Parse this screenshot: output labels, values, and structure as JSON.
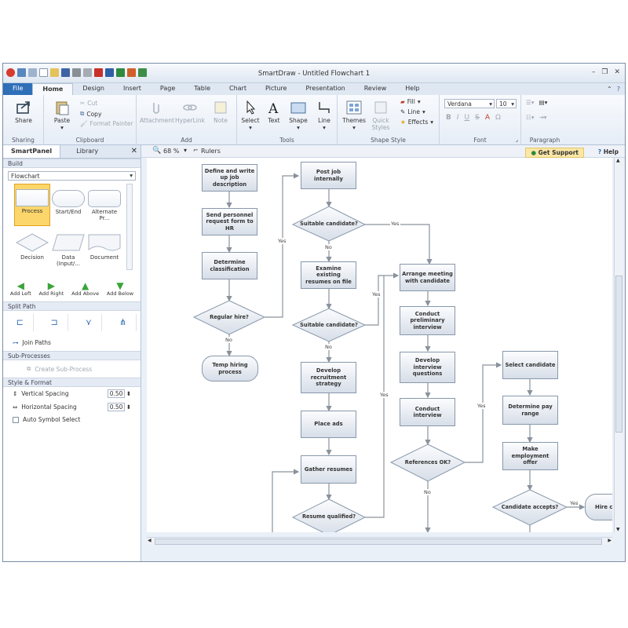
{
  "window": {
    "title": "SmartDraw - Untitled Flowchart 1"
  },
  "tabs": [
    "File",
    "Home",
    "Design",
    "Insert",
    "Page",
    "Table",
    "Chart",
    "Picture",
    "Presentation",
    "Review",
    "Help"
  ],
  "ribbon": {
    "sharing": {
      "label": "Sharing",
      "share": "Share"
    },
    "clipboard": {
      "label": "Clipboard",
      "paste": "Paste",
      "cut": "Cut",
      "copy": "Copy",
      "format_painter": "Format Painter"
    },
    "add": {
      "label": "Add",
      "attachment": "Attachment",
      "hyperlink": "HyperLink",
      "note": "Note"
    },
    "tools": {
      "label": "Tools",
      "select": "Select",
      "text": "Text",
      "shape": "Shape",
      "line": "Line"
    },
    "shape_style": {
      "label": "Shape Style",
      "themes": "Themes",
      "quick_styles_1": "Quick",
      "quick_styles_2": "Styles",
      "fill": "Fill",
      "line": "Line",
      "effects": "Effects"
    },
    "font": {
      "label": "Font",
      "name": "Verdana",
      "size": "10"
    },
    "paragraph": {
      "label": "Paragraph"
    }
  },
  "panel": {
    "tabs": [
      "SmartPanel",
      "Library"
    ],
    "build": "Build",
    "template": "Flowchart",
    "shapes": [
      "Process",
      "Start/End",
      "Alternate Pr...",
      "Decision",
      "Data (Input/...",
      "Document"
    ],
    "adds": [
      "Add Left",
      "Add Right",
      "Add Above",
      "Add Below"
    ],
    "split_path": "Split Path",
    "join_paths": "Join Paths",
    "sub_processes": "Sub-Processes",
    "create_sub": "Create Sub-Process",
    "style_format": "Style & Format",
    "vertical_spacing": "Vertical Spacing",
    "horizontal_spacing": "Horizontal Spacing",
    "v_value": "0.50",
    "h_value": "0.50",
    "auto_symbol": "Auto Symbol Select"
  },
  "canvasbar": {
    "zoom": "68 %",
    "rulers": "Rulers",
    "get_support": "Get Support",
    "help": "Help"
  },
  "flow": {
    "n1": "Define and write up job description",
    "n2": "Send personnel request form to HR",
    "n3": "Determine classification",
    "d1": "Regular hire?",
    "t1": "Temp hiring process",
    "n4": "Post job internally",
    "d2": "Suitable candidate?",
    "n5": "Examine existing resumes on file",
    "d3": "Suitable candidate?",
    "n6": "Develop recruitment strategy",
    "n7": "Place ads",
    "n8": "Gather resumes",
    "d4": "Resume qualified?",
    "n9": "Arrange meeting with candidate",
    "n10": "Conduct preliminary interview",
    "n11": "Develop interview questions",
    "n12": "Conduct interview",
    "d5": "References OK?",
    "n13": "Select candidate",
    "n14": "Determine pay range",
    "n15": "Make employment offer",
    "d6": "Candidate accepts?",
    "t2": "Hire can",
    "yes": "Yes",
    "no": "No"
  }
}
